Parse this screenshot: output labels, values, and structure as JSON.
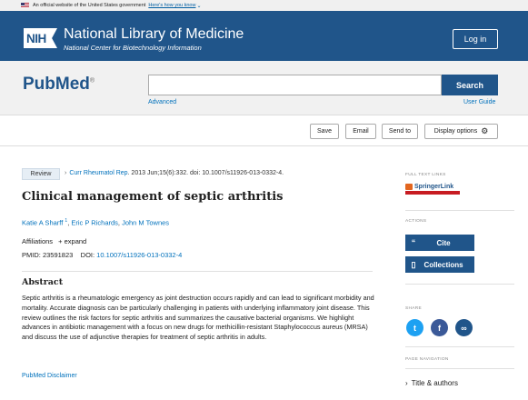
{
  "gov_banner": {
    "text": "An official website of the United States government",
    "link": "Here's how you know"
  },
  "nih": {
    "logo": "NIH",
    "title": "National Library of Medicine",
    "subtitle": "National Center for Biotechnology Information",
    "login_label": "Log in"
  },
  "search": {
    "logo": "PubMed",
    "query": "",
    "placeholder": "",
    "button": "Search",
    "advanced": "Advanced",
    "user_guide": "User Guide"
  },
  "toolbar": {
    "save": "Save",
    "email": "Email",
    "send_to": "Send to",
    "display_options": "Display options"
  },
  "article": {
    "type": "Review",
    "journal": "Curr Rheumatol Rep",
    "citation_rest": ". 2013 Jun;15(6):332. doi: 10.1007/s11926-013-0332-4.",
    "title": "Clinical management of septic arthritis",
    "authors": [
      {
        "name": "Katie A Sharff",
        "sup": "1"
      },
      {
        "name": "Eric P Richards",
        "sup": ""
      },
      {
        "name": "John M Townes",
        "sup": ""
      }
    ],
    "affiliations_label": "Affiliations",
    "expand_label": "expand",
    "pmid_label": "PMID:",
    "pmid": "23591823",
    "doi_label": "DOI:",
    "doi": "10.1007/s11926-013-0332-4",
    "abstract_heading": "Abstract",
    "abstract": "Septic arthritis is a rheumatologic emergency as joint destruction occurs rapidly and can lead to significant morbidity and mortality. Accurate diagnosis can be particularly challenging in patients with underlying inflammatory joint disease. This review outlines the risk factors for septic arthritis and summarizes the causative bacterial organisms. We highlight advances in antibiotic management with a focus on new drugs for methicillin-resistant Staphylococcus aureus (MRSA) and discuss the use of adjunctive therapies for treatment of septic arthritis in adults.",
    "disclaimer": "PubMed Disclaimer"
  },
  "sidebar": {
    "full_text_label": "FULL TEXT LINKS",
    "springer_text": "SpringerLink",
    "springer_sub": "FULL TEXT ARTICLE",
    "actions_label": "ACTIONS",
    "cite": "Cite",
    "collections": "Collections",
    "share_label": "SHARE",
    "page_nav_label": "PAGE NAVIGATION",
    "title_authors": "Title & authors"
  },
  "colors": {
    "nih_blue": "#20558a",
    "link": "#0071bc",
    "twitter": "#1da1f2",
    "facebook": "#3b5998",
    "permalink": "#20558a"
  },
  "icons": [
    "us-flag-icon",
    "gear-icon",
    "quote-icon",
    "bookmark-icon",
    "twitter-icon",
    "facebook-icon",
    "link-icon",
    "chevron-right-icon"
  ]
}
